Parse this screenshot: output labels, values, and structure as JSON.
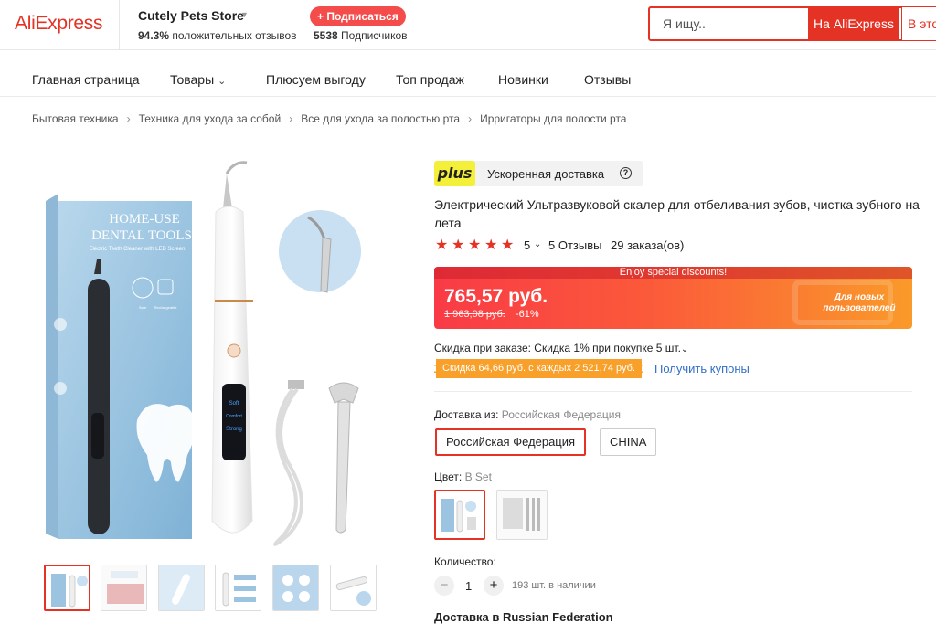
{
  "header": {
    "logo": "AliExpress",
    "store_name": "Cutely Pets Store",
    "rating_percent": "94.3%",
    "rating_text": "положительных отзывов",
    "subscribe_label": "+ Подписаться",
    "subscribers_count": "5538",
    "subscribers_text": "Подписчиков",
    "search_placeholder": "Я ищу..",
    "search_aliexpress_label": "На AliExpress",
    "search_store_label": "В это"
  },
  "nav": {
    "items": [
      "Главная страница",
      "Товары",
      "Плюсуем выгоду",
      "Топ продаж",
      "Новинки",
      "Отзывы"
    ]
  },
  "breadcrumb": [
    "Бытовая техника",
    "Техника для ухода за собой",
    "Все для ухода за полостью рта",
    "Ирригаторы для полости рта"
  ],
  "gallery": {
    "box_title_1": "HOME-USE",
    "box_title_2": "DENTAL TOOLS",
    "box_subtitle": "Electric Teeth Cleaner with LED Screen",
    "box_badge_1": "Safe",
    "box_badge_2": "Rechargeable",
    "device_modes": [
      "Soft",
      "Comfort",
      "Strong"
    ],
    "thumbnail_count": 6
  },
  "product": {
    "plus_badge": "plus",
    "plus_text": "Ускоренная доставка",
    "title": "Электрический Ультразвуковой скалер для отбеливания зубов, чистка зубного на лета",
    "rating": "5",
    "reviews": "5 Отзывы",
    "orders": "29 заказа(ов)",
    "promo_banner": "Enjoy special discounts!",
    "price": "765,57 руб.",
    "old_price": "1 963,08 руб.",
    "discount": "-61%",
    "new_users": "Для новых пользователей",
    "order_discount": "Скидка при заказе: Скидка 1% при покупке 5 шт.",
    "coupon_tag": "Скидка 64,66 руб. с каждых 2 521,74 руб.",
    "coupon_link": "Получить купоны",
    "ship_from_label": "Доставка из:",
    "ship_from_value": "Российская Федерация",
    "ship_options": [
      "Российская Федерация",
      "CHINA"
    ],
    "color_label": "Цвет:",
    "color_value": "B Set",
    "quantity_label": "Количество:",
    "quantity": "1",
    "stock": "193 шт. в наличии",
    "delivery_to": "Доставка в Russian Federation"
  },
  "colors": {
    "brand_red": "#e43225",
    "price_gradient_start": "#f93a46",
    "price_gradient_end": "#fa9a2a",
    "plus_yellow": "#f4f03a",
    "coupon_orange": "#f9a02a",
    "link_blue": "#2f6fc6"
  },
  "icons": [
    "chevron-down-icon",
    "question-circle-icon",
    "star-icon",
    "minus-icon",
    "plus-icon"
  ]
}
